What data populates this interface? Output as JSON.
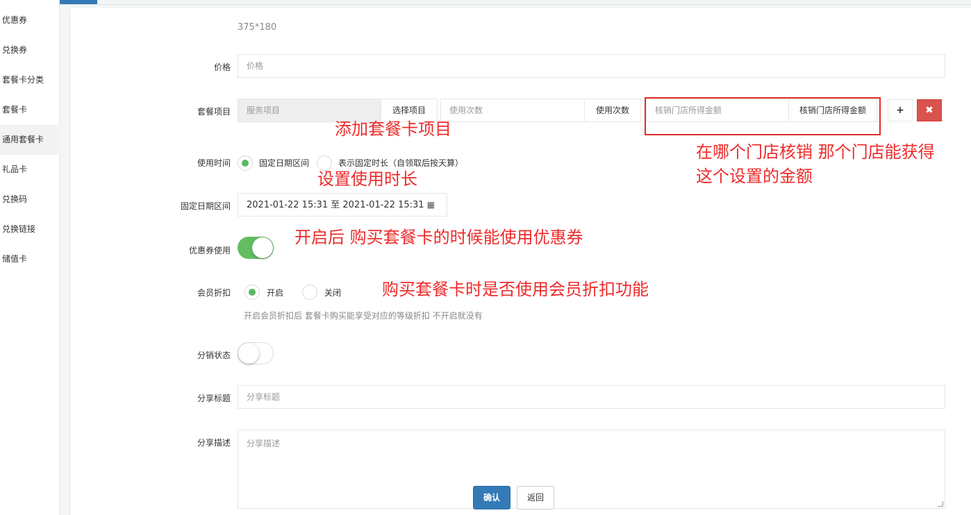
{
  "sidebar": {
    "items": [
      {
        "label": "优惠券"
      },
      {
        "label": "兑换券"
      },
      {
        "label": "套餐卡分类"
      },
      {
        "label": "套餐卡"
      },
      {
        "label": "通用套餐卡"
      },
      {
        "label": "礼品卡"
      },
      {
        "label": "兑换码"
      },
      {
        "label": "兑换链接"
      },
      {
        "label": "储值卡"
      }
    ],
    "active_index": 4
  },
  "form": {
    "image_size_hint": "375*180",
    "price": {
      "label": "价格",
      "placeholder": "价格"
    },
    "package_items": {
      "label": "套餐项目",
      "service_placeholder": "服务项目",
      "select_button": "选择项目",
      "times_placeholder": "使用次数",
      "times_addon": "使用次数",
      "store_amount_placeholder": "核销门店所得金额",
      "store_amount_addon": "核销门店所得金额",
      "add_icon": "plus-icon",
      "delete_icon": "close-icon"
    },
    "use_time": {
      "label": "使用时间",
      "option_fixed": "固定日期区间",
      "option_duration": "表示固定时长（自领取后按天算）",
      "selected": "option_fixed"
    },
    "date_range": {
      "label": "固定日期区间",
      "value": "2021-01-22 15:31 至 2021-01-22 15:31",
      "icon": "calendar-icon"
    },
    "coupon_use": {
      "label": "优惠券使用",
      "on": true
    },
    "member_discount": {
      "label": "会员折扣",
      "option_on": "开启",
      "option_off": "关闭",
      "selected": "option_on",
      "hint": "开启会员折扣后 套餐卡购买能享受对应的等级折扣 不开启就没有"
    },
    "distribution": {
      "label": "分销状态",
      "on": false
    },
    "share_title": {
      "label": "分享标题",
      "placeholder": "分享标题"
    },
    "share_desc": {
      "label": "分享描述",
      "placeholder": "分享描述"
    },
    "confirm_button": "确认",
    "back_button": "返回"
  },
  "annotations": {
    "add_item": "添加套餐卡项目",
    "store_line1": "在哪个门店核销 那个门店能获得",
    "store_line2": "这个设置的金额",
    "set_duration": "设置使用时长",
    "coupon_note": "开启后 购买套餐卡的时候能使用优惠券",
    "member_note": "购买套餐卡时是否使用会员折扣功能"
  },
  "colors": {
    "accent": "#337ab7",
    "success": "#5cb85c",
    "danger": "#d9534f",
    "annotation": "#ee2b2b"
  }
}
